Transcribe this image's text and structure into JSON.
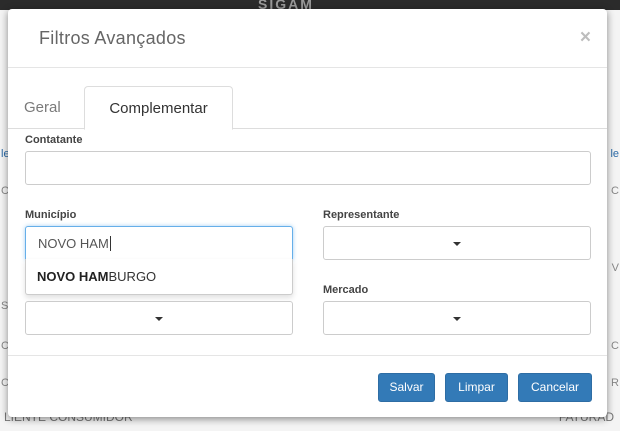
{
  "background": {
    "logo_text": "SIGAM",
    "bottom_left": "LIENTE CONSUMIDOR",
    "bottom_right": "FATURAD",
    "left_edge": [
      "le",
      "C",
      "S",
      "C",
      "C"
    ],
    "right_edge": [
      "le",
      "C",
      "V",
      "C",
      "R"
    ]
  },
  "modal": {
    "title": "Filtros Avançados",
    "close_glyph": "×",
    "tabs": [
      {
        "label": "Geral",
        "active": false
      },
      {
        "label": "Complementar",
        "active": true
      }
    ],
    "fields": {
      "contatante": {
        "label": "Contatante",
        "value": ""
      },
      "municipio": {
        "label": "Município",
        "value": "NOVO HAM"
      },
      "representante": {
        "label": "Representante",
        "value": ""
      },
      "mercado": {
        "label": "Mercado",
        "value": ""
      }
    },
    "autocomplete": {
      "match": "NOVO HAM",
      "rest": "BURGO"
    },
    "buttons": {
      "salvar": "Salvar",
      "limpar": "Limpar",
      "cancelar": "Cancelar"
    }
  },
  "colors": {
    "primary_button": "#337ab7",
    "focus_border": "#66afe9"
  }
}
